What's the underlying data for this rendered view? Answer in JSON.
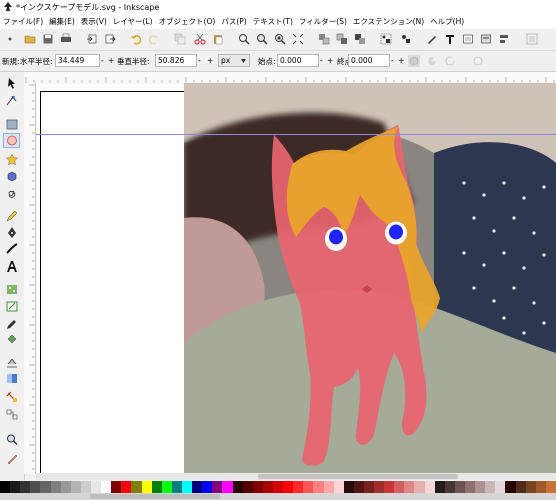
{
  "window": {
    "title": "*インクスケープモデル.svg - Inkscape"
  },
  "menu": [
    "ファイル(F)",
    "編集(E)",
    "表示(V)",
    "レイヤー(L)",
    "オブジェクト(O)",
    "パス(P)",
    "テキスト(T)",
    "フィルター(S)",
    "エクステンション(N)",
    "ヘルプ(H)"
  ],
  "controls": {
    "mode_label": "新規:",
    "rx_label": "水平半径:",
    "rx_value": "34.449",
    "ry_label": "垂直半径:",
    "ry_value": "50.826",
    "unit": "px",
    "start_label": "始点:",
    "start_value": "0.000",
    "end_label": "終点:",
    "end_value": "0.000",
    "plus": "+",
    "minus": "-"
  },
  "colors": {
    "cat_fill": "#e8656f",
    "hair_fill": "#e8a52a",
    "eye_white": "#ffffff",
    "eye_iris": "#1f23ff",
    "guide_line": "#8a8ad8"
  },
  "palette": [
    "#000000",
    "#1a1a1a",
    "#333333",
    "#4d4d4d",
    "#666666",
    "#808080",
    "#999999",
    "#b3b3b3",
    "#cccccc",
    "#e6e6e6",
    "#ffffff",
    "#800000",
    "#ff0000",
    "#808000",
    "#ffff00",
    "#008000",
    "#00ff00",
    "#008080",
    "#00ffff",
    "#000080",
    "#0000ff",
    "#800080",
    "#ff00ff",
    "#2b0000",
    "#550000",
    "#800000",
    "#aa0000",
    "#d40000",
    "#ff0000",
    "#ff2a2a",
    "#ff5555",
    "#ff8080",
    "#ffaaaa",
    "#ffd5d5",
    "#280b0b",
    "#501616",
    "#782121",
    "#a02c2c",
    "#c83737",
    "#d35f5f",
    "#de8787",
    "#e9afaf",
    "#f4d7d7",
    "#241c1c",
    "#483737",
    "#6c5353",
    "#916f6f",
    "#ac9393",
    "#c8b7b7",
    "#e3dbdb",
    "#280000",
    "#502d16",
    "#784421",
    "#a05a2c",
    "#c87137"
  ]
}
